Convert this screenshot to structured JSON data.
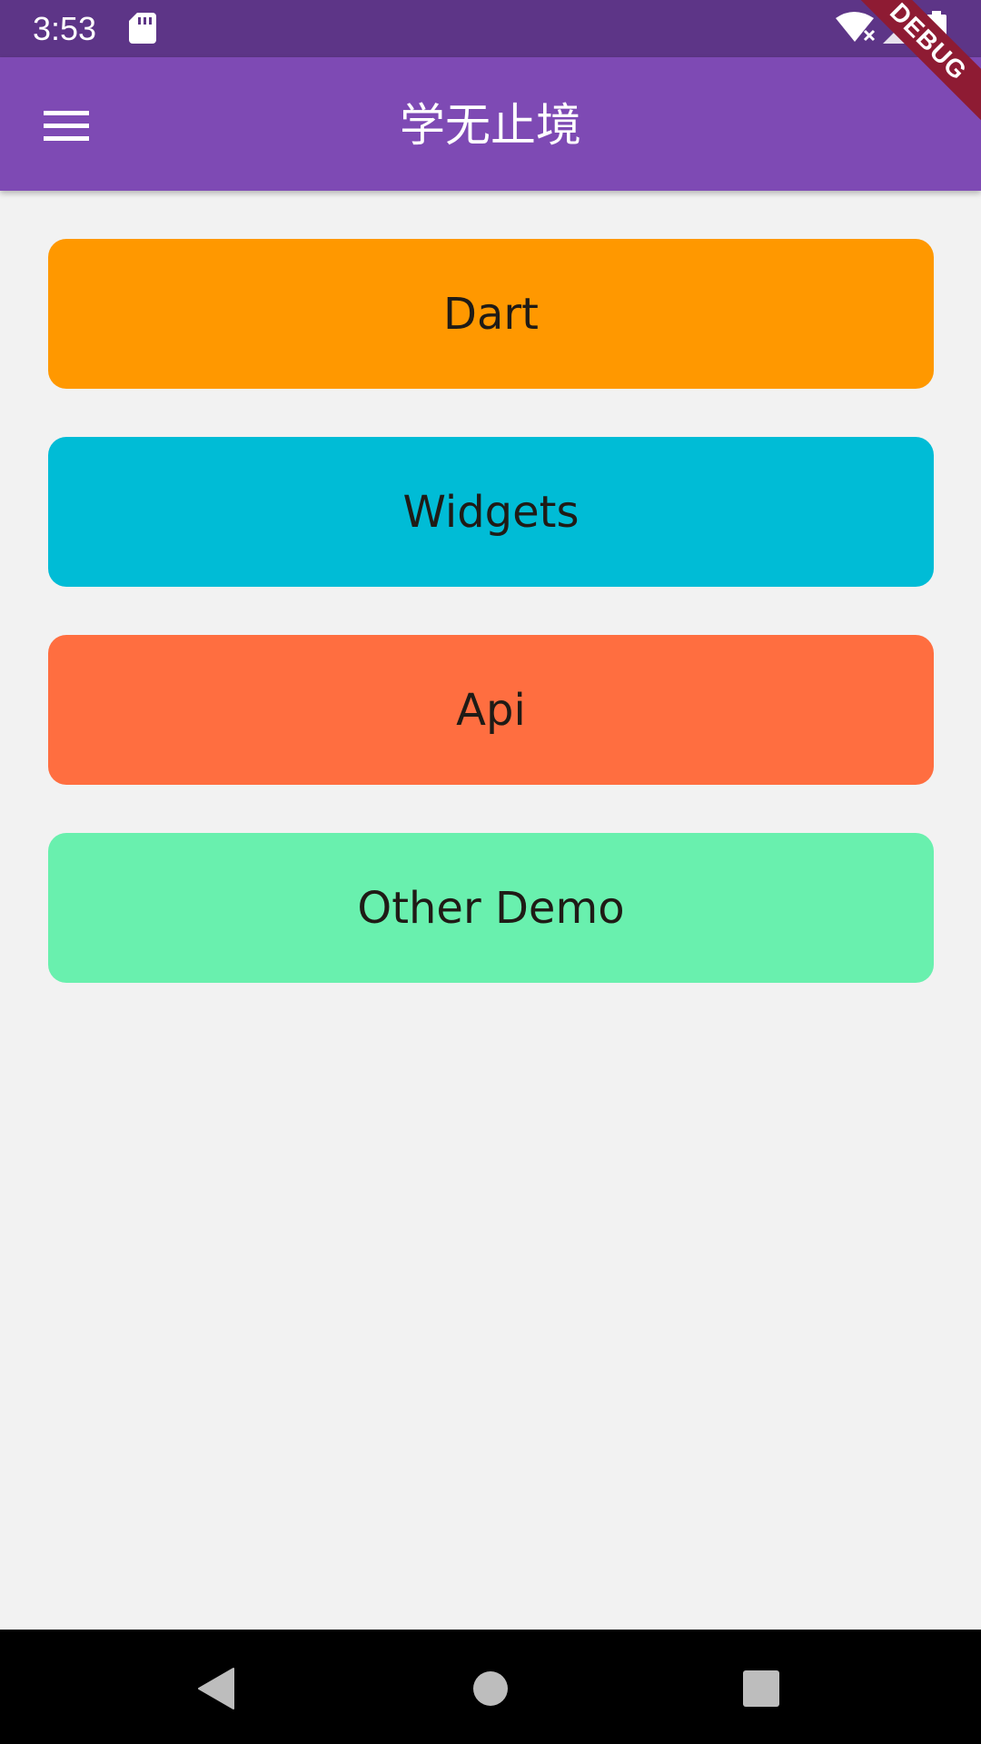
{
  "status_bar": {
    "time": "3:53",
    "icons": [
      "sd-card-icon",
      "wifi-icon",
      "signal-icon",
      "battery-icon"
    ]
  },
  "app_bar": {
    "title": "学无止境",
    "menu_icon": "hamburger-menu-icon",
    "background_color": "#7e4ab4"
  },
  "debug_banner": {
    "label": "DEBUG"
  },
  "buttons": [
    {
      "label": "Dart",
      "color": "#ff9800"
    },
    {
      "label": "Widgets",
      "color": "#00bcd6"
    },
    {
      "label": "Api",
      "color": "#ff6e40"
    },
    {
      "label": "Other Demo",
      "color": "#69f0ae"
    }
  ],
  "nav_bar": {
    "items": [
      "back-icon",
      "home-icon",
      "recents-icon"
    ]
  }
}
